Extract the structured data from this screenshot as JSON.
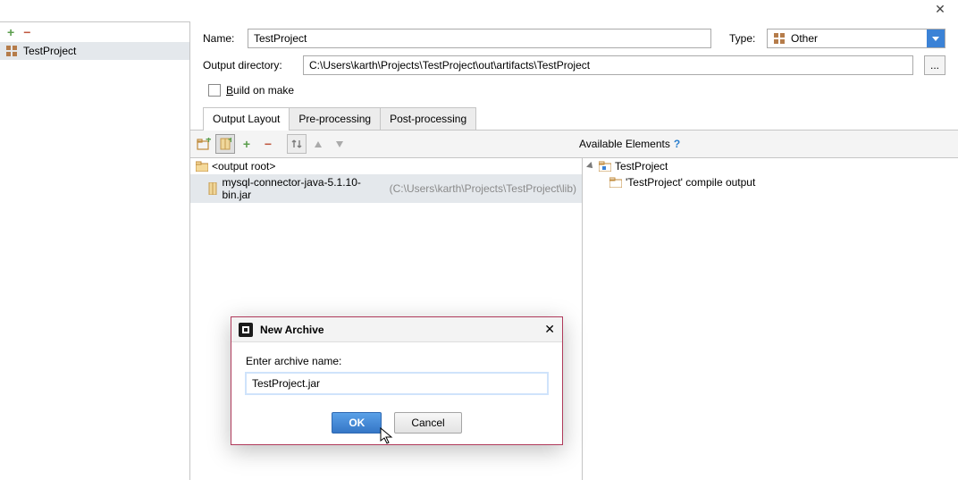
{
  "sidebar": {
    "items": [
      {
        "label": "TestProject"
      }
    ]
  },
  "form": {
    "name_label": "Name:",
    "name_value": "TestProject",
    "type_label": "Type:",
    "type_value": "Other",
    "out_dir_label": "Output directory:",
    "out_dir_value": "C:\\Users\\karth\\Projects\\TestProject\\out\\artifacts\\TestProject",
    "build_on_make_label": "Build on make"
  },
  "tabs": {
    "t0": "Output Layout",
    "t1": "Pre-processing",
    "t2": "Post-processing"
  },
  "available_label": "Available Elements",
  "output_tree": {
    "root_label": "<output root>",
    "item0_name": "mysql-connector-java-5.1.10-bin.jar",
    "item0_path": "(C:\\Users\\karth\\Projects\\TestProject\\lib)"
  },
  "avail_tree": {
    "project": "TestProject",
    "item0": "'TestProject' compile output"
  },
  "dialog": {
    "title": "New Archive",
    "prompt": "Enter archive name:",
    "value": "TestProject.jar",
    "ok": "OK",
    "cancel": "Cancel"
  },
  "browse_label": "..."
}
